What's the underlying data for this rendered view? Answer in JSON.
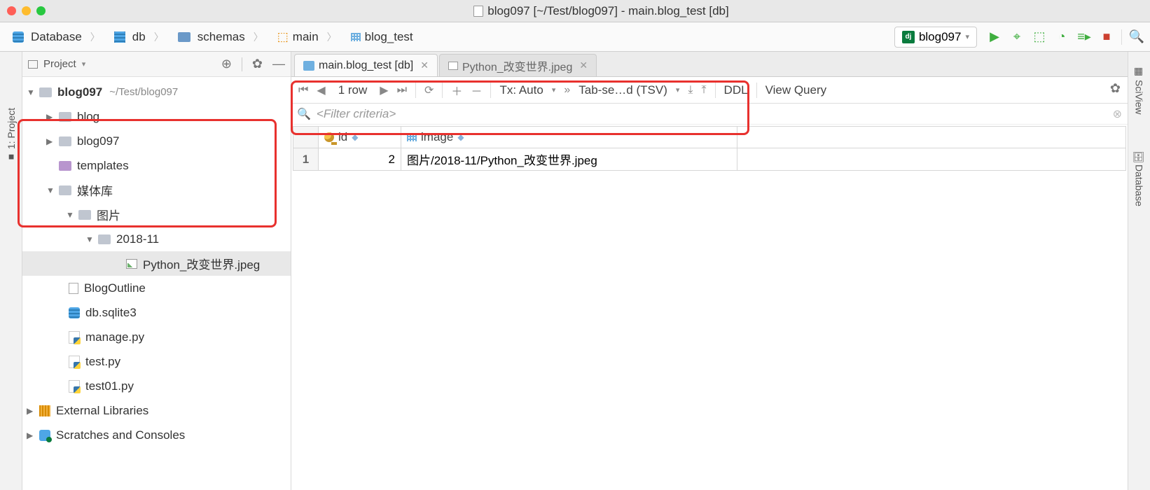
{
  "titlebar": {
    "title": "blog097 [~/Test/blog097] - main.blog_test [db]"
  },
  "breadcrumbs": {
    "items": [
      "Database",
      "db",
      "schemas",
      "main",
      "blog_test"
    ]
  },
  "run_config": {
    "name": "blog097"
  },
  "sidebar": {
    "header": "Project",
    "tree": {
      "root": "blog097",
      "root_path": "~/Test/blog097",
      "blog": "blog",
      "blog097": "blog097",
      "templates": "templates",
      "media": "媒体库",
      "pictures": "图片",
      "datefolder": "2018-11",
      "imagefile": "Python_改变世界.jpeg",
      "blogoutline": "BlogOutline",
      "sqlite": "db.sqlite3",
      "managepy": "manage.py",
      "testpy": "test.py",
      "test01py": "test01.py",
      "extlibs": "External Libraries",
      "scratches": "Scratches and Consoles"
    }
  },
  "tabs": {
    "tab1": "main.blog_test [db]",
    "tab2": "Python_改变世界.jpeg"
  },
  "toolbar": {
    "rows": "1 row",
    "tx": "Tx: Auto",
    "format": "Tab-se…d (TSV)",
    "ddl": "DDL",
    "viewquery": "View Query"
  },
  "filter": {
    "placeholder": "<Filter criteria>"
  },
  "table": {
    "columns": {
      "id": "id",
      "image": "image"
    },
    "row": {
      "num": "1",
      "id": "2",
      "image": "图片/2018-11/Python_改变世界.jpeg"
    }
  },
  "leftpanel": {
    "project": "1: Project"
  },
  "rightpanel": {
    "sciview": "SciView",
    "database": "Database"
  }
}
